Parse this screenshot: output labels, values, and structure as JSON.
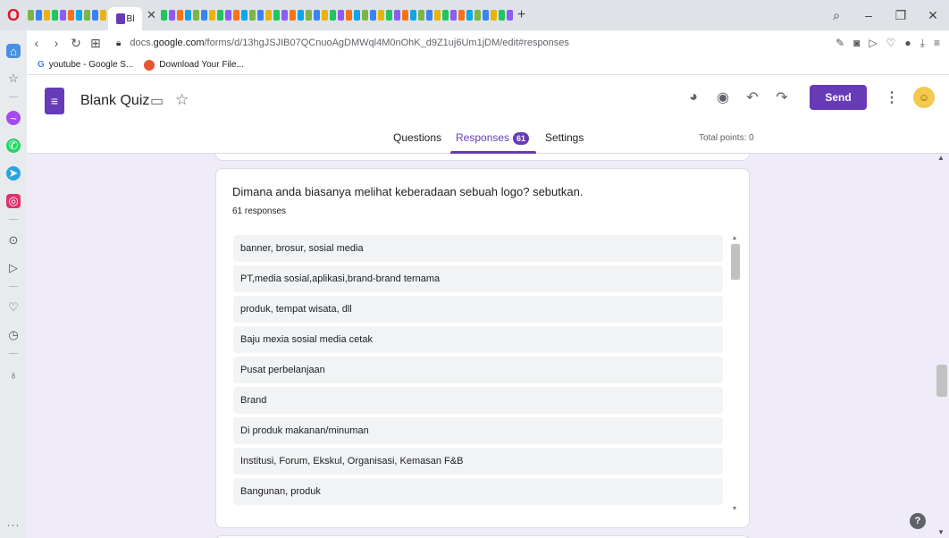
{
  "browser": {
    "active_tab_label": "Bl",
    "url_prefix": "docs.",
    "url_host": "google.com",
    "url_path": "/forms/d/13hgJSJIB07QCnuoAgDMWql4M0nOhK_d9Z1uj6Um1jDM/edit#responses",
    "bookmarks": [
      "youtube - Google S...",
      "Download Your File..."
    ]
  },
  "form": {
    "title": "Blank Quiz",
    "send_label": "Send",
    "tabs": {
      "questions": "Questions",
      "responses": "Responses",
      "responses_count": "61",
      "settings": "Settings"
    },
    "total_points": "Total points: 0"
  },
  "question": {
    "title": "Dimana anda biasanya melihat keberadaan sebuah logo? sebutkan.",
    "count_label": "61 responses",
    "answers": [
      "banner, brosur, sosial media",
      "PT,media sosial,aplikasi,brand-brand ternama",
      "produk, tempat wisata, dll",
      "Baju mexia sosial media cetak",
      "Pusat perbelanjaan",
      "Brand",
      "Di produk makanan/minuman",
      "Institusi, Forum, Ekskul, Organisasi, Kemasan F&B",
      "Bangunan, produk"
    ]
  },
  "colors": {
    "accent": "#673ab7",
    "background": "#f0ebf8"
  },
  "icons": {
    "help": "?"
  }
}
